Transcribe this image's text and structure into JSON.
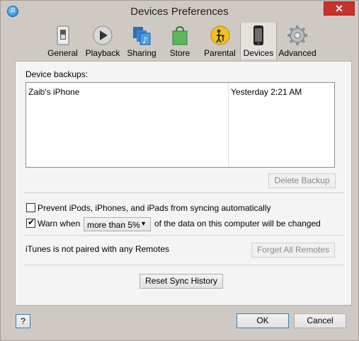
{
  "window": {
    "title": "Devices Preferences",
    "close_glyph": "✕"
  },
  "toolbar": {
    "items": [
      {
        "label": "General",
        "icon": "switch-icon"
      },
      {
        "label": "Playback",
        "icon": "play-icon"
      },
      {
        "label": "Sharing",
        "icon": "music-library-icon"
      },
      {
        "label": "Store",
        "icon": "shopping-bag-icon"
      },
      {
        "label": "Parental",
        "icon": "parental-icon"
      },
      {
        "label": "Devices",
        "icon": "iphone-icon"
      },
      {
        "label": "Advanced",
        "icon": "gear-icon"
      }
    ],
    "selected": "Devices"
  },
  "backups": {
    "label": "Device backups:",
    "rows": [
      {
        "name": "Zaib's iPhone",
        "date": "Yesterday 2:21 AM"
      }
    ],
    "delete_label": "Delete Backup"
  },
  "sync": {
    "prevent_label": "Prevent iPods, iPhones, and iPads from syncing automatically",
    "prevent_checked": false,
    "warn_label": "Warn when",
    "warn_checked": true,
    "warn_threshold": "more than 5%",
    "warn_suffix": "of the data on this computer will be changed"
  },
  "remotes": {
    "status": "iTunes is not paired with any Remotes",
    "forget_label": "Forget All Remotes"
  },
  "reset_label": "Reset Sync History",
  "footer": {
    "help_label": "?",
    "ok_label": "OK",
    "cancel_label": "Cancel"
  },
  "colors": {
    "accent": "#3c7fb1",
    "close": "#c7322b"
  }
}
